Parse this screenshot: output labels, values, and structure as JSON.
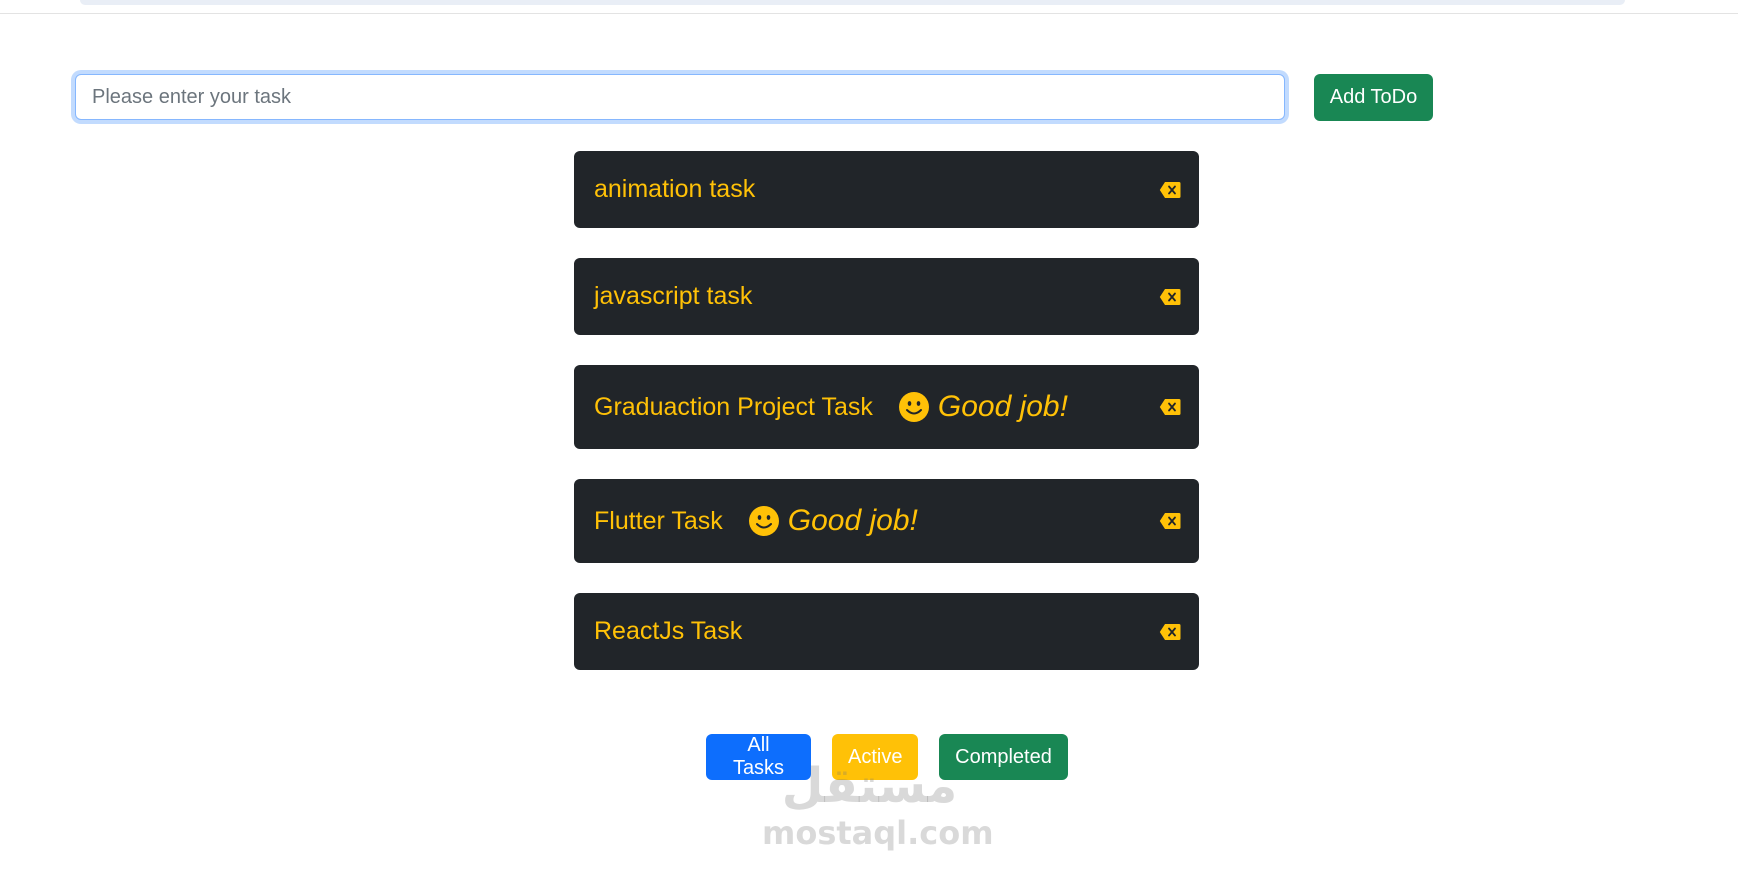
{
  "input": {
    "placeholder": "Please enter your task",
    "value": ""
  },
  "add_button": {
    "label": "Add ToDo"
  },
  "tasks": [
    {
      "text": "animation task",
      "completed": false
    },
    {
      "text": "javascript task",
      "completed": false
    },
    {
      "text": "Graduaction Project Task",
      "completed": true,
      "badge": "Good job!"
    },
    {
      "text": "Flutter Task",
      "completed": true,
      "badge": "Good job!"
    },
    {
      "text": "ReactJs Task",
      "completed": false
    }
  ],
  "filters": {
    "all": "All Tasks",
    "active": "Active",
    "completed": "Completed"
  },
  "watermark": {
    "arabic": "مستقل",
    "latin": "mostaql.com"
  },
  "colors": {
    "primary": "#0d6efd",
    "warning": "#ffc107",
    "success": "#198754",
    "dark": "#212529"
  },
  "icons": {
    "delete": "backspace-x-icon",
    "completed_badge": "smile-icon"
  }
}
